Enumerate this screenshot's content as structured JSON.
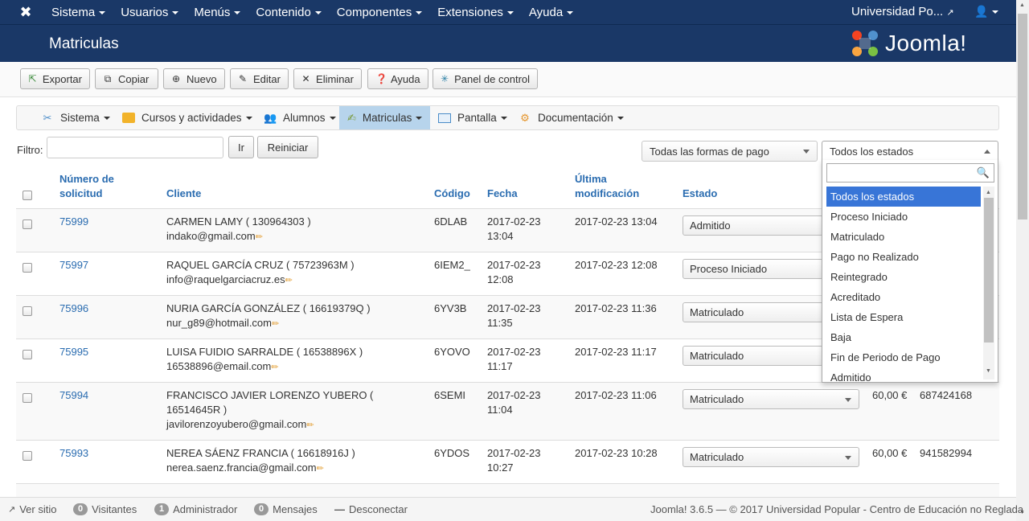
{
  "topnav": {
    "menus": [
      "Sistema",
      "Usuarios",
      "Menús",
      "Contenido",
      "Componentes",
      "Extensiones",
      "Ayuda"
    ],
    "site_name": "Universidad Po...",
    "user_icon": "user-icon"
  },
  "header": {
    "title": "Matriculas",
    "brand": "Joomla!"
  },
  "toolbar": {
    "export": "Exportar",
    "copy": "Copiar",
    "new": "Nuevo",
    "edit": "Editar",
    "delete": "Eliminar",
    "help": "Ayuda",
    "panel": "Panel de control"
  },
  "component_nav": {
    "items": [
      "Sistema",
      "Cursos y actividades",
      "Alumnos",
      "Matriculas",
      "Pantalla",
      "Documentación"
    ],
    "active": "Matriculas"
  },
  "filter": {
    "label": "Filtro:",
    "value": "",
    "go": "Ir",
    "reset": "Reiniciar",
    "payment_select": "Todas las formas de pago",
    "status_select": "Todos los estados"
  },
  "table": {
    "headers": {
      "number_1": "Número de",
      "number_2": "solicitud",
      "client": "Cliente",
      "code": "Código",
      "date": "Fecha",
      "modified_1": "Última",
      "modified_2": "modificación",
      "status": "Estado"
    },
    "rows": [
      {
        "num": "75999",
        "client": "CARMEN LAMY ( 130964303 )",
        "email": "indako@gmail.com",
        "code": "6DLAB",
        "date1": "2017-02-23",
        "date2": "13:04",
        "modified": "2017-02-23 13:04",
        "status": "Admitido",
        "amount": "",
        "phone": ""
      },
      {
        "num": "75997",
        "client": "RAQUEL GARCÍA CRUZ ( 75723963M )",
        "email": "info@raquelgarciacruz.es",
        "code": "6IEM2_",
        "date1": "2017-02-23",
        "date2": "12:08",
        "modified": "2017-02-23 12:08",
        "status": "Proceso Iniciado",
        "amount": "",
        "phone": ""
      },
      {
        "num": "75996",
        "client": "NURIA GARCÍA GONZÁLEZ ( 16619379Q )",
        "email": "nur_g89@hotmail.com",
        "code": "6YV3B",
        "date1": "2017-02-23",
        "date2": "11:35",
        "modified": "2017-02-23 11:36",
        "status": "Matriculado",
        "amount": "",
        "phone": ""
      },
      {
        "num": "75995",
        "client": "LUISA FUIDIO SARRALDE ( 16538896X )",
        "email": "16538896@email.com",
        "code": "6YOVO",
        "date1": "2017-02-23",
        "date2": "11:17",
        "modified": "2017-02-23 11:17",
        "status": "Matriculado",
        "amount": "",
        "phone": ""
      },
      {
        "num": "75994",
        "client": "FRANCISCO JAVIER LORENZO YUBERO (",
        "client2": "16514645R )",
        "email": "javilorenzoyubero@gmail.com",
        "code": "6SEMI",
        "date1": "2017-02-23",
        "date2": "11:04",
        "modified": "2017-02-23 11:06",
        "status": "Matriculado",
        "amount": "60,00 €",
        "phone": "687424168"
      },
      {
        "num": "75993",
        "client": "NEREA SÁENZ FRANCIA ( 16618916J )",
        "email": "nerea.saenz.francia@gmail.com",
        "code": "6YDOS",
        "date1": "2017-02-23",
        "date2": "10:27",
        "modified": "2017-02-23 10:28",
        "status": "Matriculado",
        "amount": "60,00 €",
        "phone": "941582994"
      }
    ]
  },
  "dropdown": {
    "search_value": "",
    "options": [
      "Todos los estados",
      "Proceso Iniciado",
      "Matriculado",
      "Pago no Realizado",
      "Reintegrado",
      "Acreditado",
      "Lista de Espera",
      "Baja",
      "Fin de Periodo de Pago",
      "Admitido"
    ],
    "highlighted": "Todos los estados"
  },
  "footer": {
    "view_site": "Ver sitio",
    "visitors_count": "0",
    "visitors": "Visitantes",
    "admin_count": "1",
    "admin": "Administrador",
    "messages_count": "0",
    "messages": "Mensajes",
    "logout": "Desconectar",
    "copyright": "Joomla! 3.6.5 — © 2017 Universidad Popular - Centro de Educación no Reglada"
  },
  "colors": {
    "navbar": "#1a3867",
    "link": "#2a6cb0",
    "highlight": "#3875d7",
    "active_tab": "#b7d4ec"
  }
}
